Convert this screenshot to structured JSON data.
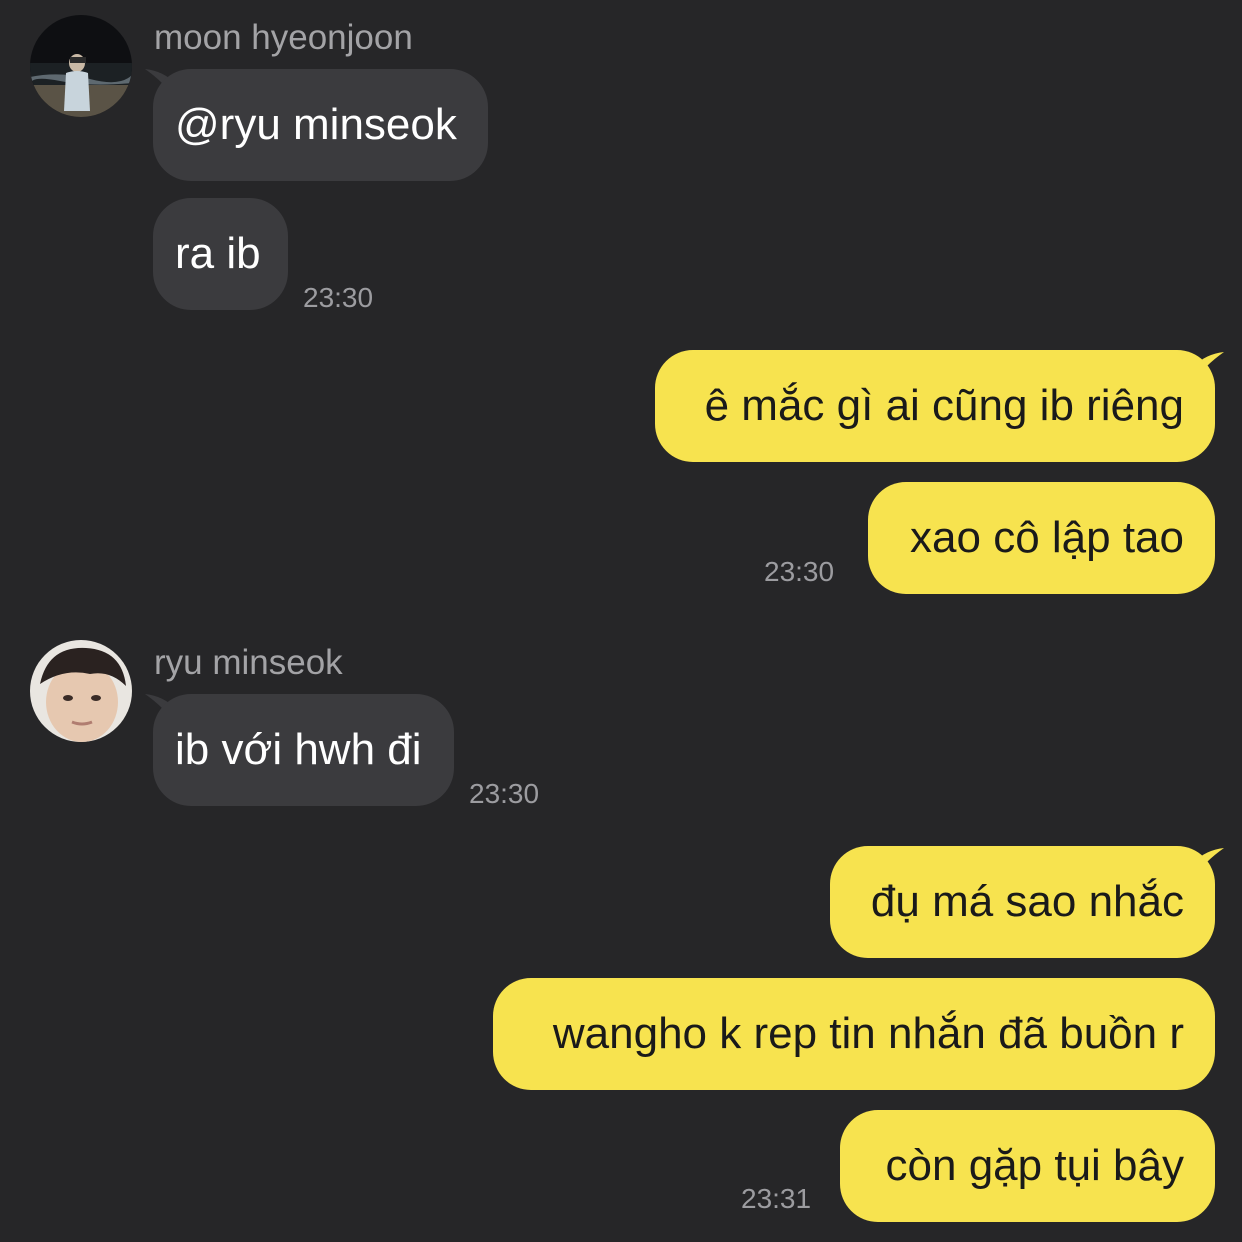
{
  "colors": {
    "background": "#262628",
    "incoming_bubble": "#3b3b3e",
    "outgoing_bubble": "#f7e34f",
    "sender_name": "#a3a3a6",
    "timestamp": "#9c9ca0"
  },
  "groups": [
    {
      "sender": "moon hyeonjoon",
      "avatar": "avatar-moon-hyeonjoon",
      "messages": [
        "@ryu minseok",
        "ra ib"
      ],
      "time": "23:30"
    },
    {
      "sender": "me",
      "messages": [
        "ê mắc gì ai cũng ib riêng",
        "xao cô lập tao"
      ],
      "time": "23:30"
    },
    {
      "sender": "ryu minseok",
      "avatar": "avatar-ryu-minseok",
      "messages": [
        "ib với hwh đi"
      ],
      "time": "23:30"
    },
    {
      "sender": "me",
      "messages": [
        "đụ má sao nhắc",
        "wangho k rep tin nhắn đã buồn r",
        "còn gặp tụi bây"
      ],
      "time": "23:31"
    }
  ]
}
